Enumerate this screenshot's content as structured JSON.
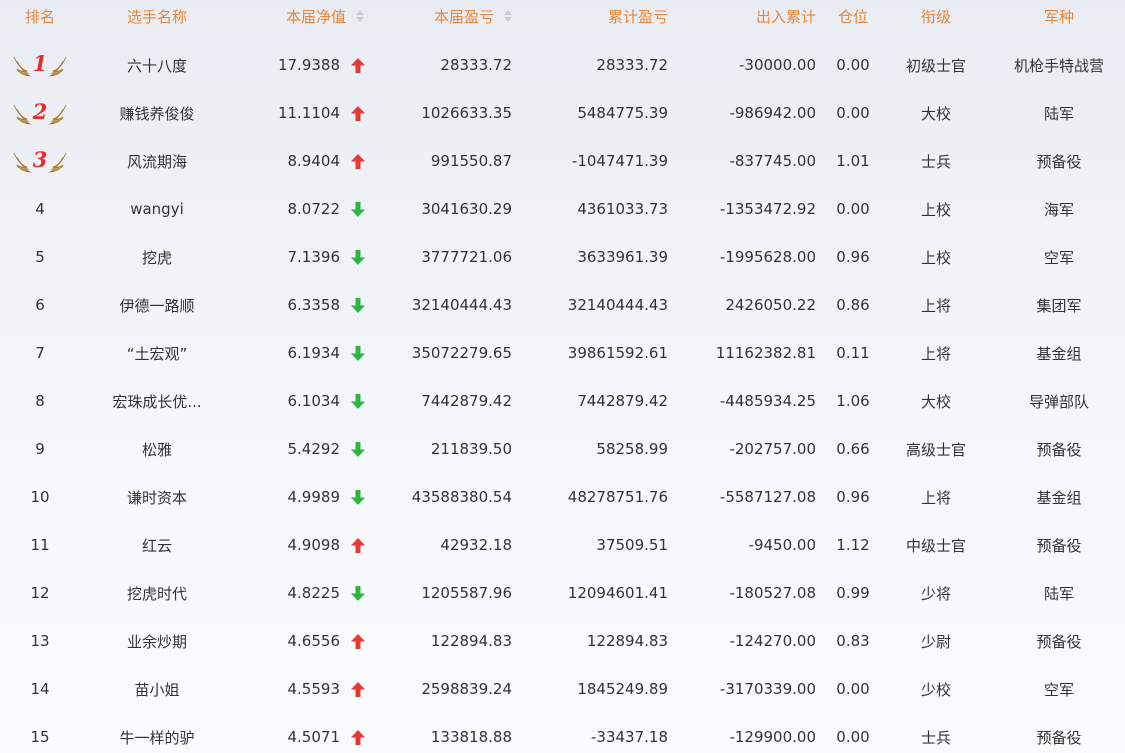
{
  "columns": {
    "rank": "排名",
    "name": "选手名称",
    "net_value": "本届净值",
    "profit": "本届盈亏",
    "cumulative": "累计盈亏",
    "flow": "出入累计",
    "position": "仓位",
    "title": "衔级",
    "army": "军种"
  },
  "colors": {
    "header_text": "#e8873a",
    "up_arrow": "#e53935",
    "down_arrow": "#2fb344",
    "medal_number": "#e42c2c"
  },
  "rows": [
    {
      "rank": "1",
      "medal": true,
      "name": "六十八度",
      "net_value": "17.9388",
      "trend": "up",
      "profit": "28333.72",
      "cumulative": "28333.72",
      "flow": "-30000.00",
      "position": "0.00",
      "title": "初级士官",
      "army": "机枪手特战营"
    },
    {
      "rank": "2",
      "medal": true,
      "name": "赚钱养俊俊",
      "net_value": "11.1104",
      "trend": "up",
      "profit": "1026633.35",
      "cumulative": "5484775.39",
      "flow": "-986942.00",
      "position": "0.00",
      "title": "大校",
      "army": "陆军"
    },
    {
      "rank": "3",
      "medal": true,
      "name": "风流期海",
      "net_value": "8.9404",
      "trend": "up",
      "profit": "991550.87",
      "cumulative": "-1047471.39",
      "flow": "-837745.00",
      "position": "1.01",
      "title": "士兵",
      "army": "预备役"
    },
    {
      "rank": "4",
      "medal": false,
      "name": "wangyi",
      "net_value": "8.0722",
      "trend": "down",
      "profit": "3041630.29",
      "cumulative": "4361033.73",
      "flow": "-1353472.92",
      "position": "0.00",
      "title": "上校",
      "army": "海军"
    },
    {
      "rank": "5",
      "medal": false,
      "name": "挖虎",
      "net_value": "7.1396",
      "trend": "down",
      "profit": "3777721.06",
      "cumulative": "3633961.39",
      "flow": "-1995628.00",
      "position": "0.96",
      "title": "上校",
      "army": "空军"
    },
    {
      "rank": "6",
      "medal": false,
      "name": "伊德一路顺",
      "net_value": "6.3358",
      "trend": "down",
      "profit": "32140444.43",
      "cumulative": "32140444.43",
      "flow": "2426050.22",
      "position": "0.86",
      "title": "上将",
      "army": "集团军"
    },
    {
      "rank": "7",
      "medal": false,
      "name": "“土宏观”",
      "net_value": "6.1934",
      "trend": "down",
      "profit": "35072279.65",
      "cumulative": "39861592.61",
      "flow": "11162382.81",
      "position": "0.11",
      "title": "上将",
      "army": "基金组"
    },
    {
      "rank": "8",
      "medal": false,
      "name": "宏珠成长优...",
      "net_value": "6.1034",
      "trend": "down",
      "profit": "7442879.42",
      "cumulative": "7442879.42",
      "flow": "-4485934.25",
      "position": "1.06",
      "title": "大校",
      "army": "导弹部队"
    },
    {
      "rank": "9",
      "medal": false,
      "name": "松雅",
      "net_value": "5.4292",
      "trend": "down",
      "profit": "211839.50",
      "cumulative": "58258.99",
      "flow": "-202757.00",
      "position": "0.66",
      "title": "高级士官",
      "army": "预备役"
    },
    {
      "rank": "10",
      "medal": false,
      "name": "谦时资本",
      "net_value": "4.9989",
      "trend": "down",
      "profit": "43588380.54",
      "cumulative": "48278751.76",
      "flow": "-5587127.08",
      "position": "0.96",
      "title": "上将",
      "army": "基金组"
    },
    {
      "rank": "11",
      "medal": false,
      "name": "红云",
      "net_value": "4.9098",
      "trend": "up",
      "profit": "42932.18",
      "cumulative": "37509.51",
      "flow": "-9450.00",
      "position": "1.12",
      "title": "中级士官",
      "army": "预备役"
    },
    {
      "rank": "12",
      "medal": false,
      "name": "挖虎时代",
      "net_value": "4.8225",
      "trend": "down",
      "profit": "1205587.96",
      "cumulative": "12094601.41",
      "flow": "-180527.08",
      "position": "0.99",
      "title": "少将",
      "army": "陆军"
    },
    {
      "rank": "13",
      "medal": false,
      "name": "业余炒期",
      "net_value": "4.6556",
      "trend": "up",
      "profit": "122894.83",
      "cumulative": "122894.83",
      "flow": "-124270.00",
      "position": "0.83",
      "title": "少尉",
      "army": "预备役"
    },
    {
      "rank": "14",
      "medal": false,
      "name": "苗小姐",
      "net_value": "4.5593",
      "trend": "up",
      "profit": "2598839.24",
      "cumulative": "1845249.89",
      "flow": "-3170339.00",
      "position": "0.00",
      "title": "少校",
      "army": "空军"
    },
    {
      "rank": "15",
      "medal": false,
      "name": "牛一样的驴",
      "net_value": "4.5071",
      "trend": "up",
      "profit": "133818.88",
      "cumulative": "-33437.18",
      "flow": "-129900.00",
      "position": "0.00",
      "title": "士兵",
      "army": "预备役"
    }
  ]
}
